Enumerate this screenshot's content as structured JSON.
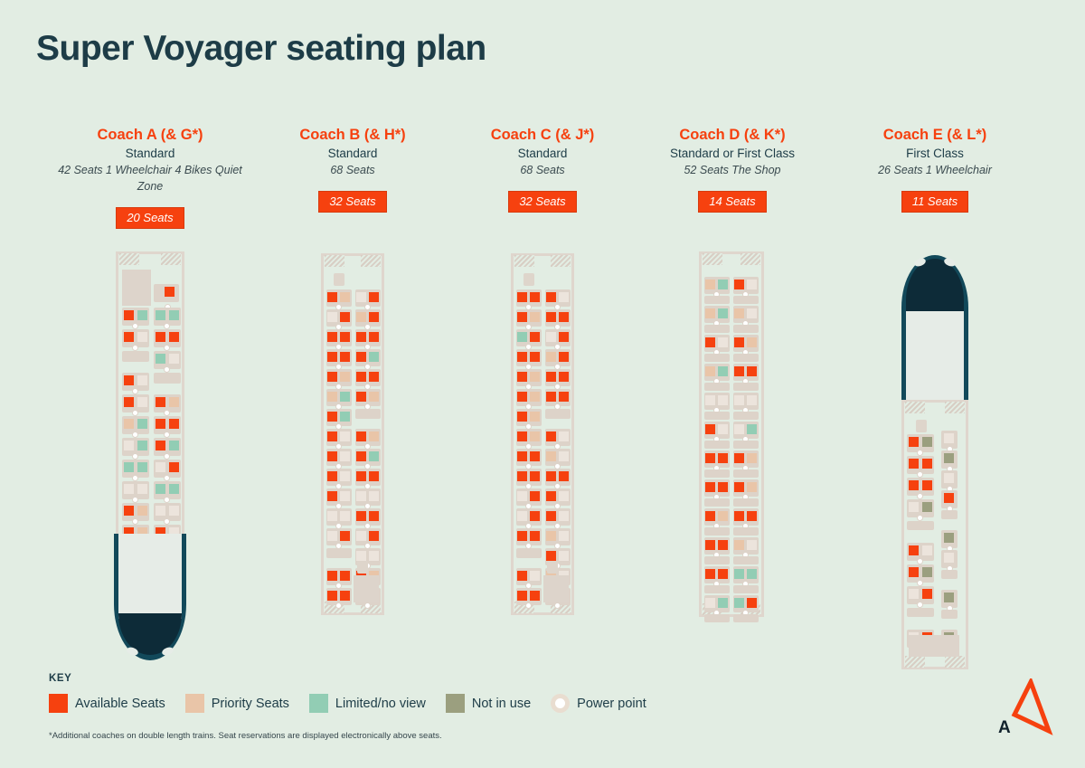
{
  "page": {
    "title": "Super Voyager seating plan",
    "background_color": "#e2ede3",
    "brand_orange": "#f6410f",
    "brand_navy": "#1d3c47"
  },
  "coaches": [
    {
      "id": "coach-a",
      "name": "Coach A (& G*)",
      "class": "Standard",
      "facts": "42 Seats  1 Wheelchair  4 Bikes  Quiet Zone",
      "available_badge": "20 Seats",
      "nose": "bottom"
    },
    {
      "id": "coach-b",
      "name": "Coach B (& H*)",
      "class": "Standard",
      "facts": "68 Seats",
      "available_badge": "32 Seats",
      "nose": "none"
    },
    {
      "id": "coach-c",
      "name": "Coach C (& J*)",
      "class": "Standard",
      "facts": "68 Seats",
      "available_badge": "32 Seats",
      "nose": "none"
    },
    {
      "id": "coach-d",
      "name": "Coach D (& K*)",
      "class": "Standard or First Class",
      "facts": "52 Seats The Shop",
      "available_badge": "14 Seats",
      "nose": "none"
    },
    {
      "id": "coach-e",
      "name": "Coach E (& L*)",
      "class": "First Class",
      "facts": "26 Seats  1 Wheelchair",
      "available_badge": "11 Seats",
      "nose": "top"
    }
  ],
  "key": {
    "heading": "KEY",
    "items": [
      {
        "label": "Available Seats",
        "color": "#f6410f",
        "shape": "square"
      },
      {
        "label": "Priority Seats",
        "color": "#e9c5a8",
        "shape": "square"
      },
      {
        "label": "Limited/no view",
        "color": "#92cdb4",
        "shape": "square"
      },
      {
        "label": "Not in use",
        "color": "#9b9f7f",
        "shape": "square"
      },
      {
        "label": "Power point",
        "color": "#e9ddd0",
        "shape": "ring"
      }
    ]
  },
  "footnote": "*Additional coaches on double length trains. Seat reservations are displayed electronically above seats.",
  "logo": {
    "letter": "A",
    "color": "#f6410f"
  }
}
